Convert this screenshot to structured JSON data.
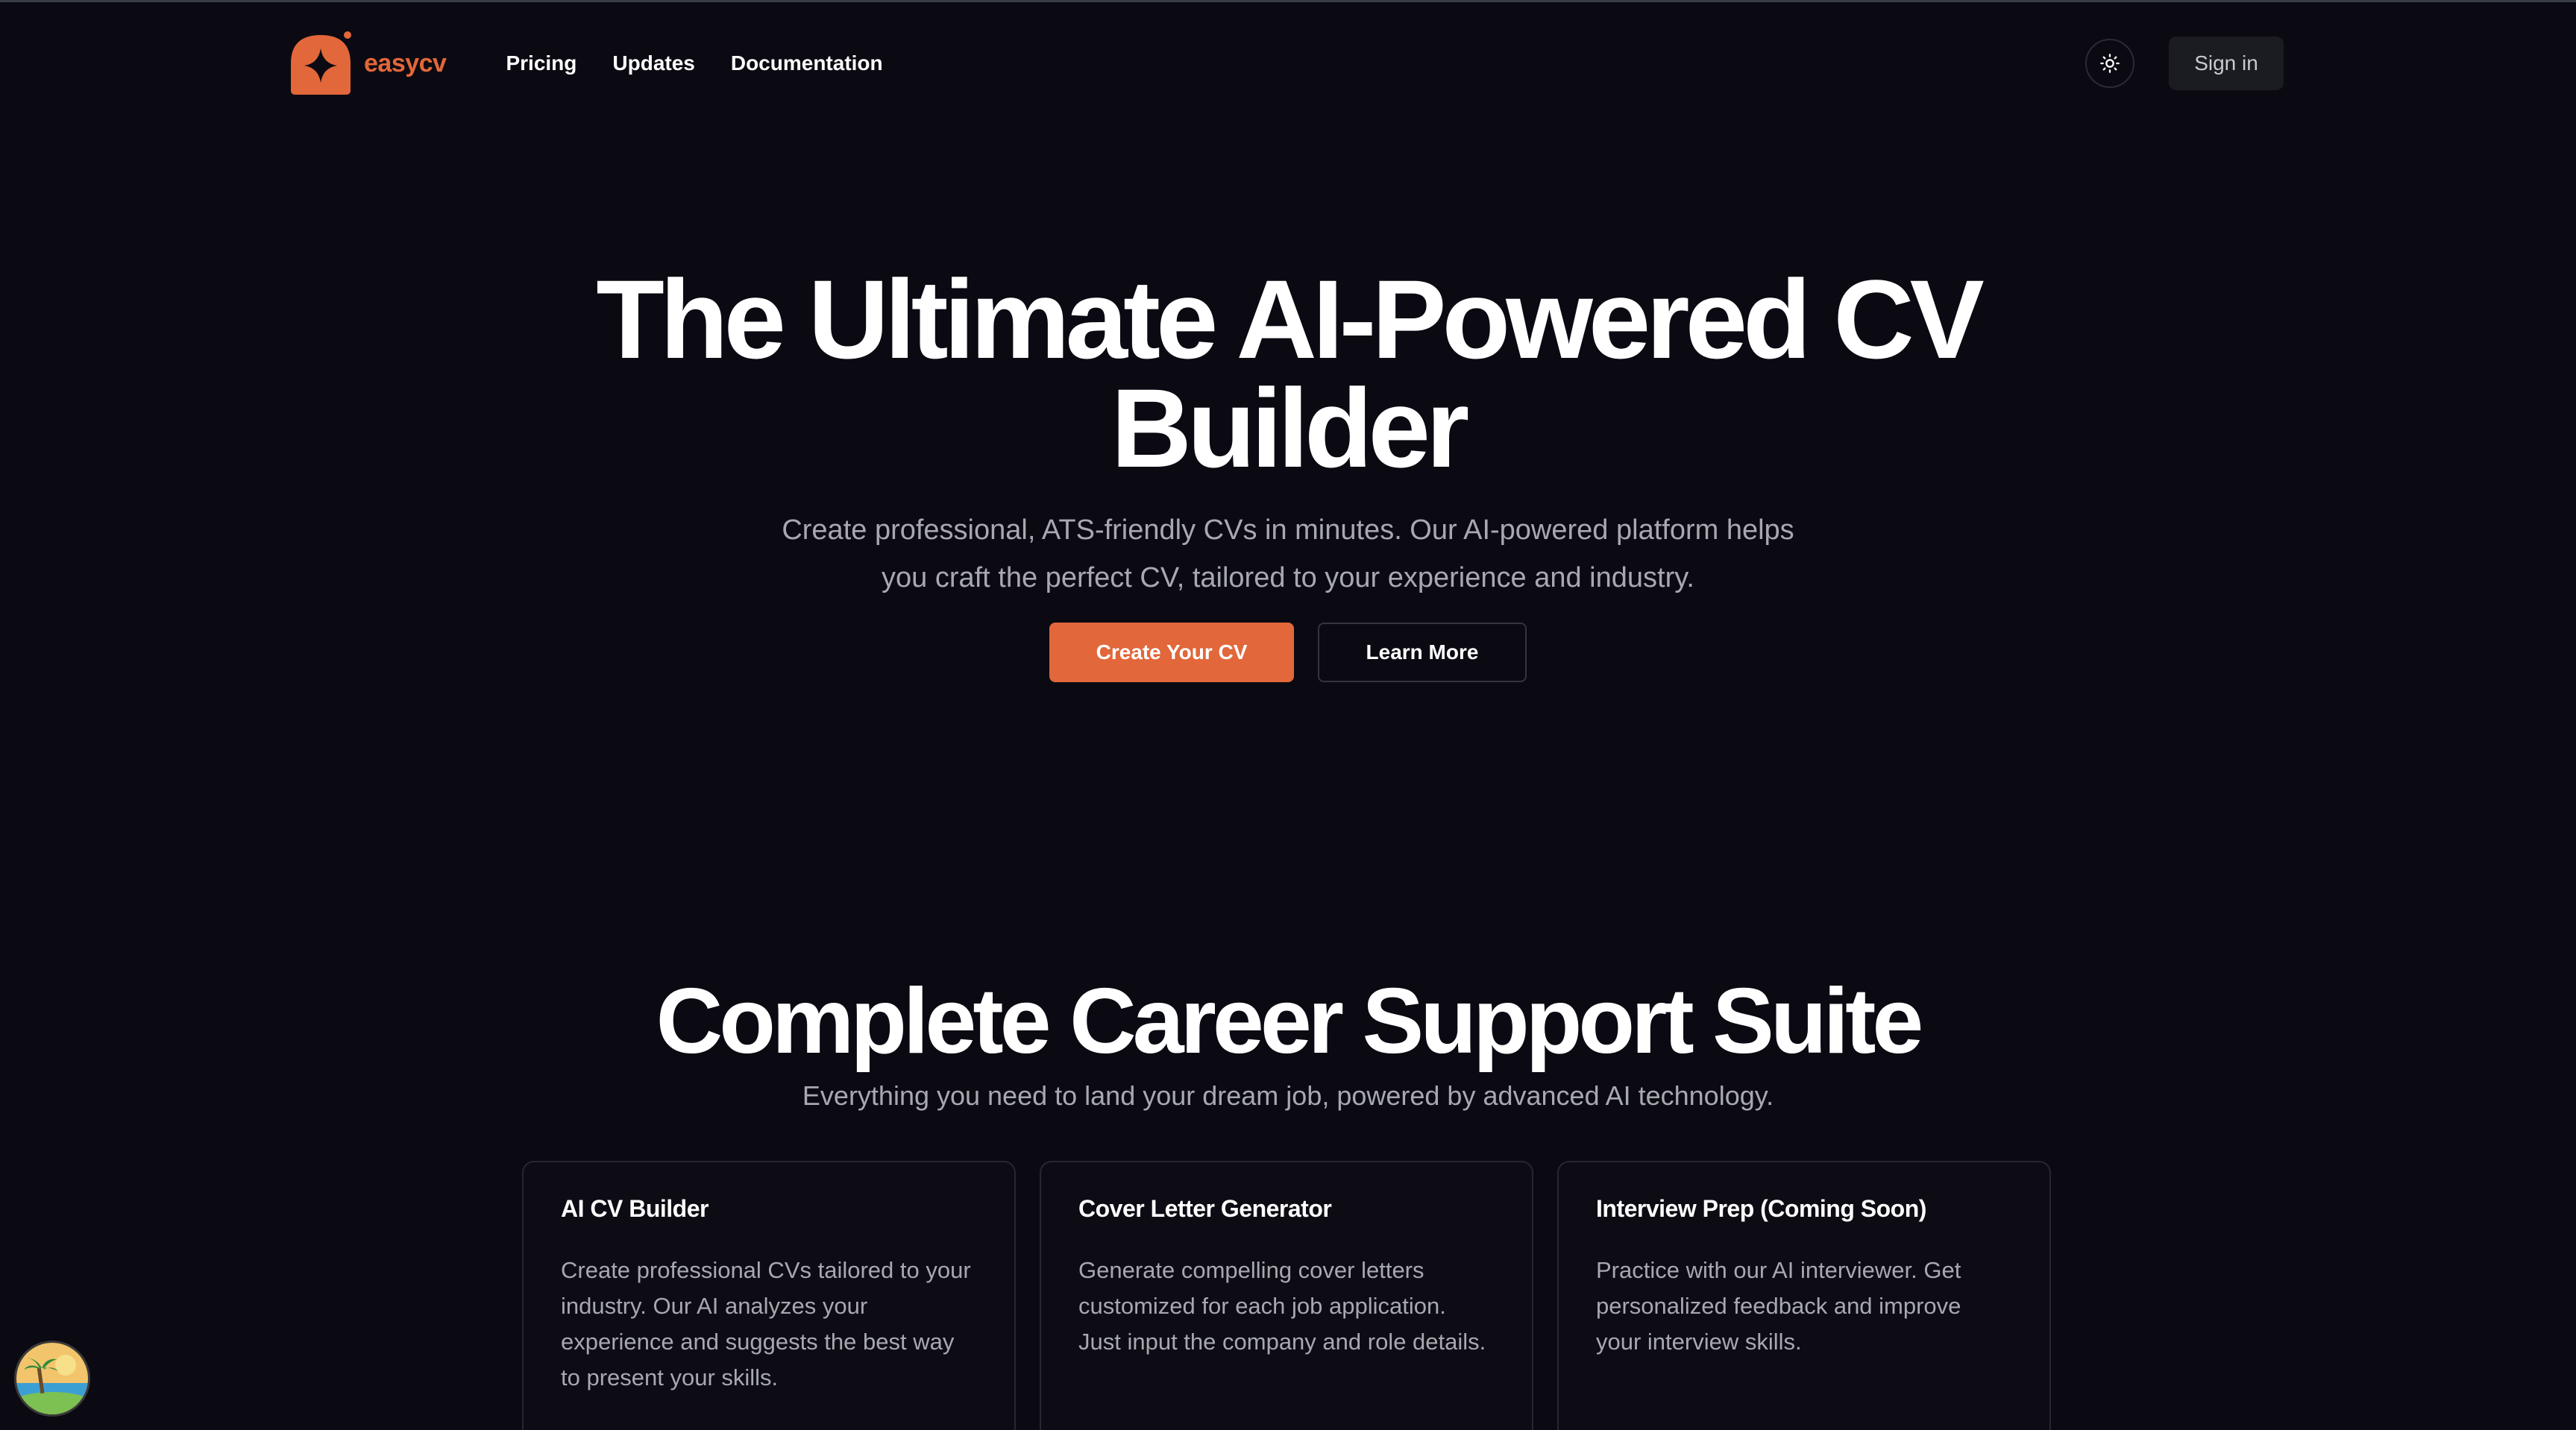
{
  "brand": {
    "name": "easycv",
    "color": "#e2673a"
  },
  "nav": {
    "items": [
      {
        "label": "Pricing"
      },
      {
        "label": "Updates"
      },
      {
        "label": "Documentation"
      }
    ]
  },
  "header": {
    "theme_toggle_icon": "sun-icon",
    "signin_label": "Sign in"
  },
  "hero": {
    "title_line1": "The Ultimate AI-Powered CV",
    "title_line2": "Builder",
    "subtitle": "Create professional, ATS-friendly CVs in minutes. Our AI-powered platform helps you craft the perfect CV, tailored to your experience and industry.",
    "primary_button": "Create Your CV",
    "secondary_button": "Learn More"
  },
  "features": {
    "title": "Complete Career Support Suite",
    "subtitle": "Everything you need to land your dream job, powered by advanced AI technology.",
    "cards": [
      {
        "title": "AI CV Builder",
        "text": "Create professional CVs tailored to your industry. Our AI analyzes your experience and suggests the best way to present your skills."
      },
      {
        "title": "Cover Letter Generator",
        "text": "Generate compelling cover letters customized for each job application. Just input the company and role details."
      },
      {
        "title": "Interview Prep (Coming Soon)",
        "text": "Practice with our AI interviewer. Get personalized feedback and improve your interview skills."
      }
    ]
  },
  "colors": {
    "background": "#0b0a12",
    "accent": "#e2673a",
    "muted_text": "#a7a8b0"
  }
}
